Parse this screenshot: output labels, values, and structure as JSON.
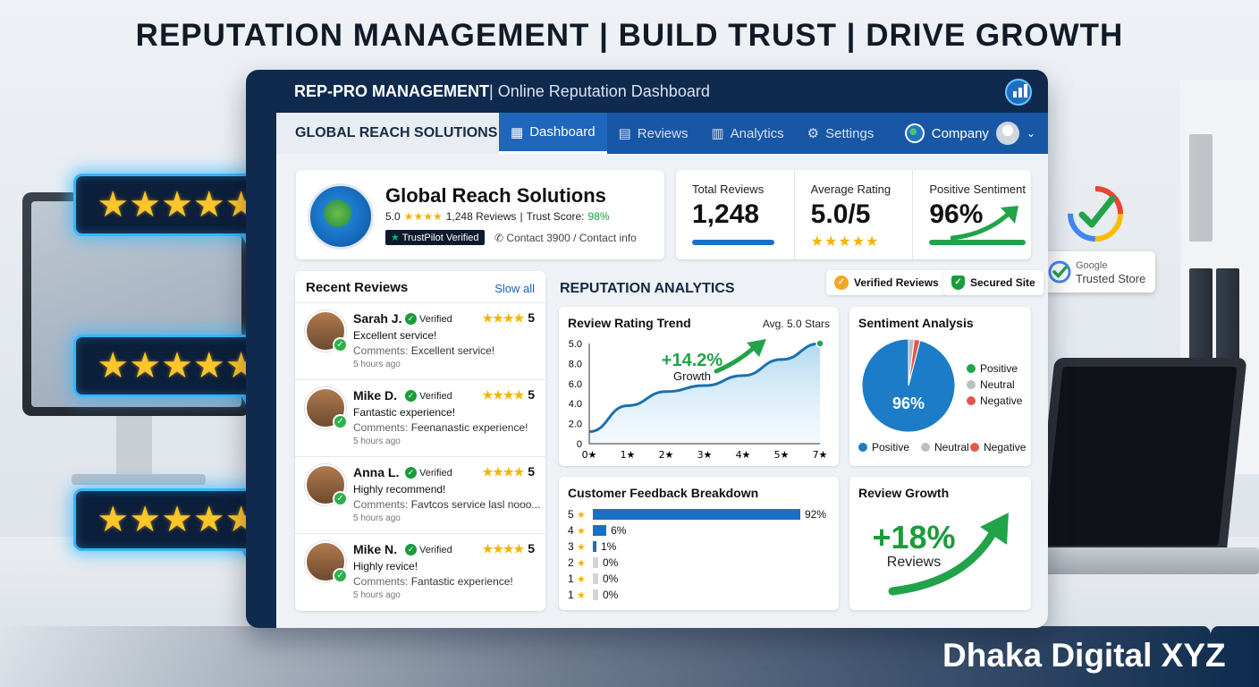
{
  "headline": "REPUTATION MANAGEMENT | BUILD TRUST | DRIVE GROWTH",
  "brand_mark": "Dhaka Digital XYZ",
  "colors": {
    "dark_navy": "#102a4e",
    "nav_blue": "#1757a6",
    "accent_blue": "#1c6fc6",
    "green": "#22a34a",
    "star": "#f4b400",
    "glow": "#36b6ff"
  },
  "window": {
    "title_bold": "REP-PRO MANAGEMENT",
    "title_rest": " | Online Reputation Dashboard",
    "logo_icon": "bar-chart-icon"
  },
  "nav": {
    "brand": "GLOBAL REACH SOLUTIONS",
    "items": [
      {
        "label": "Dashboard",
        "icon": "dashboard-icon",
        "active": true
      },
      {
        "label": "Reviews",
        "icon": "message-icon"
      },
      {
        "label": "Analytics",
        "icon": "bar-chart-icon"
      },
      {
        "label": "Settings",
        "icon": "gear-icon"
      }
    ],
    "company": "Company"
  },
  "profile": {
    "name": "Global Reach Solutions",
    "rating": "5.0",
    "stars": "★★★★",
    "reviews": "1,248 Reviews",
    "trust_label": "Trust Score:",
    "trust_value": "98%",
    "badge": "TrustPilot Verified",
    "contact": "Contact 3900 / Contact info"
  },
  "stats": [
    {
      "label": "Total Reviews",
      "value": "1,248"
    },
    {
      "label": "Average Rating",
      "value": "5.0/5",
      "stars": "★★★★★"
    },
    {
      "label": "Positive Sentiment",
      "value": "96%"
    }
  ],
  "recent_reviews": {
    "title": "Recent Reviews",
    "link": "Slow all",
    "verified_label": "Verified",
    "items": [
      {
        "name": "Sarah J.",
        "stars": "★★★★",
        "score": "5",
        "text": "Excellent service!",
        "comment_label": "Comments:",
        "comment": "Excellent service!",
        "time": "5 hours ago"
      },
      {
        "name": "Mike D.",
        "stars": "★★★★",
        "score": "5",
        "text": "Fantastic experience!",
        "comment_label": "Comments:",
        "comment": "Feenanastic experience!",
        "time": "5 hours ago"
      },
      {
        "name": "Anna L.",
        "stars": "★★★★",
        "score": "5",
        "text": "Highly recommend!",
        "comment_label": "Comments:",
        "comment": "Favtcos service lasl nooo...",
        "time": "5 hours ago"
      },
      {
        "name": "Mike N.",
        "stars": "★★★★",
        "score": "5",
        "text": "Highly revice!",
        "comment_label": "Comments:",
        "comment": "Fantastic experience!",
        "time": "5 hours ago"
      }
    ]
  },
  "analytics": {
    "title": "REPUTATION ANALYTICS",
    "pill_verified": "Verified Reviews",
    "pill_secured": "Secured Site"
  },
  "trend": {
    "title": "Review Rating Trend",
    "avg": "Avg. 5.0 Stars",
    "growth_value": "+14.2%",
    "growth_label": "Growth"
  },
  "chart_data": {
    "type": "area",
    "title": "Review Rating Trend",
    "y_ticks": [
      "5.0",
      "8.0",
      "6.0",
      "4.0",
      "2.0",
      "0"
    ],
    "x_ticks": [
      "0★",
      "1★",
      "2★",
      "3★",
      "4★",
      "5★",
      "7★"
    ],
    "x": [
      0,
      1,
      2,
      3,
      4,
      5,
      6
    ],
    "values": [
      0.6,
      1.9,
      2.6,
      2.9,
      3.4,
      4.2,
      5.0
    ],
    "ylim": [
      0,
      5
    ]
  },
  "sentiment": {
    "title": "Sentiment Analysis",
    "center_label": "96%",
    "slices": [
      {
        "name": "Positive",
        "value": 96,
        "color": "#1c7cc7"
      },
      {
        "name": "Neutral",
        "value": 2,
        "color": "#b9bfc6"
      },
      {
        "name": "Negative",
        "value": 2,
        "color": "#e2574c"
      }
    ],
    "legend_right": [
      "Positive",
      "Neutral",
      "Negative"
    ],
    "legend_bottom": [
      "Positive",
      "Neutral",
      "Negative"
    ],
    "legend_right_colors": [
      "#22a34a",
      "#b9bfc6",
      "#e2574c"
    ]
  },
  "feedback": {
    "title": "Customer Feedback Breakdown",
    "rows": [
      {
        "label": "5",
        "pct": "92%",
        "value": 92
      },
      {
        "label": "4",
        "pct": "6%",
        "value": 6
      },
      {
        "label": "3",
        "pct": "1%",
        "value": 1
      },
      {
        "label": "2",
        "pct": "0%",
        "value": 0
      },
      {
        "label": "1",
        "pct": "0%",
        "value": 0
      },
      {
        "label": "1",
        "pct": "0%",
        "value": 0
      }
    ]
  },
  "growth": {
    "title": "Review Growth",
    "value": "+18%",
    "label": "Reviews"
  },
  "google": {
    "line1": "Google",
    "line2": "Trusted Store"
  },
  "bubbles": [
    {
      "stars": "★★★★★"
    },
    {
      "stars": "★★★★★"
    },
    {
      "stars": "★★★★★"
    }
  ]
}
